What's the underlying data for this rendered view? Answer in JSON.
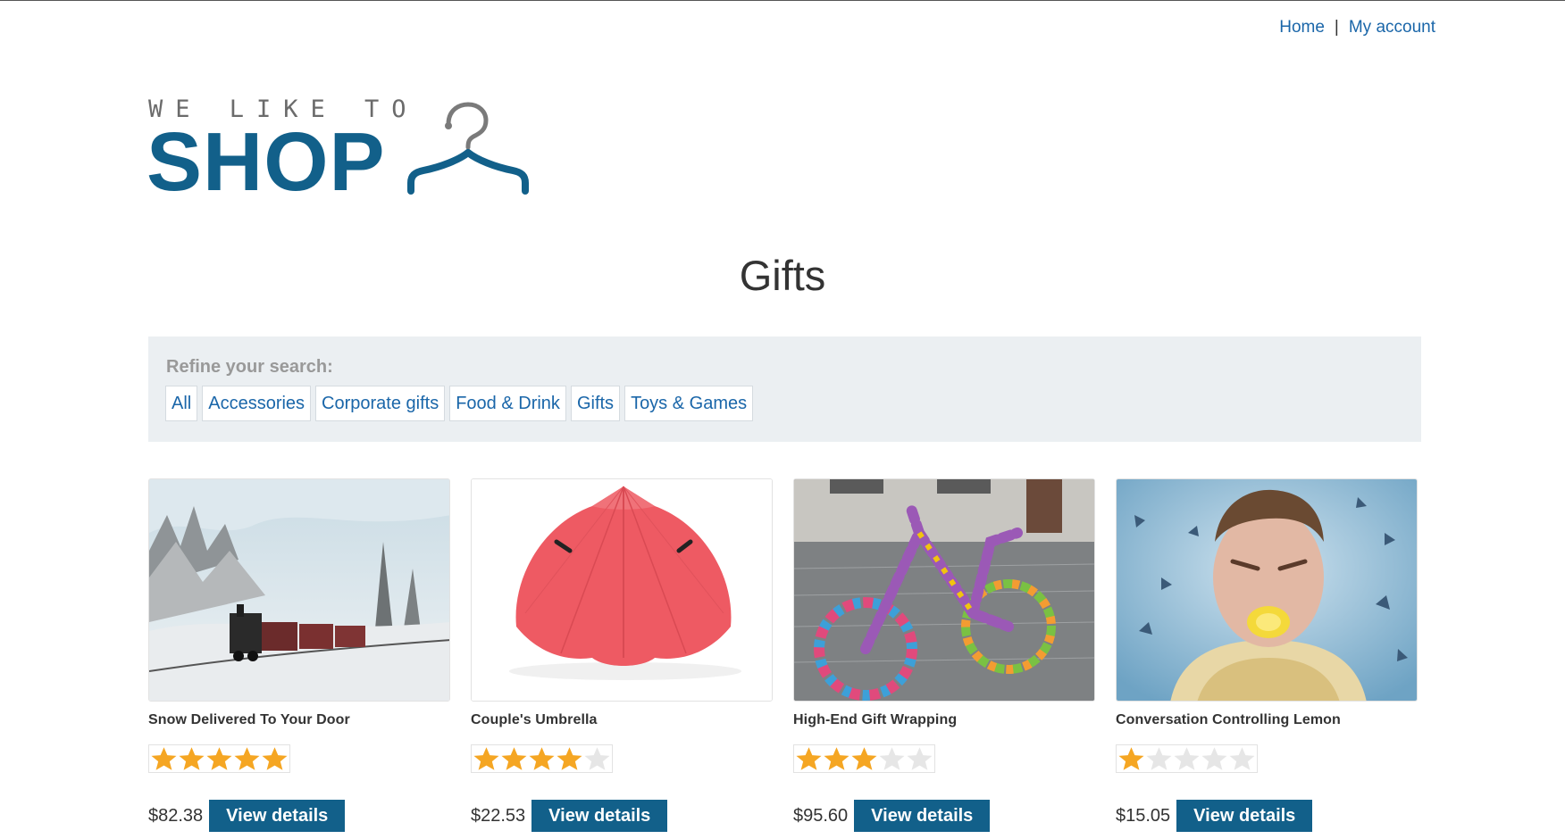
{
  "nav": {
    "home": "Home",
    "separator": "|",
    "account": "My account"
  },
  "logo": {
    "tagline": "WE LIKE TO",
    "name": "SHOP"
  },
  "page_title": "Gifts",
  "refine": {
    "label": "Refine your search:",
    "filters": [
      "All",
      "Accessories",
      "Corporate gifts",
      "Food & Drink",
      "Gifts",
      "Toys & Games"
    ]
  },
  "products": [
    {
      "name": "Snow Delivered To Your Door",
      "rating": 5,
      "price": "$82.38",
      "button": "View details",
      "image": "snowy-steam-train-photo"
    },
    {
      "name": "Couple's Umbrella",
      "rating": 4,
      "price": "$22.53",
      "button": "View details",
      "image": "red-double-umbrella-photo"
    },
    {
      "name": "High-End Gift Wrapping",
      "rating": 3,
      "price": "$95.60",
      "button": "View details",
      "image": "yarn-wrapped-bicycle-photo"
    },
    {
      "name": "Conversation Controlling Lemon",
      "rating": 1,
      "price": "$15.05",
      "button": "View details",
      "image": "man-biting-lemon-photo"
    }
  ],
  "colors": {
    "brand": "#12608a",
    "link": "#1a66a9",
    "star_on": "#f5a623",
    "star_off": "#e6e6e6",
    "refine_bg": "#ebeff2"
  }
}
